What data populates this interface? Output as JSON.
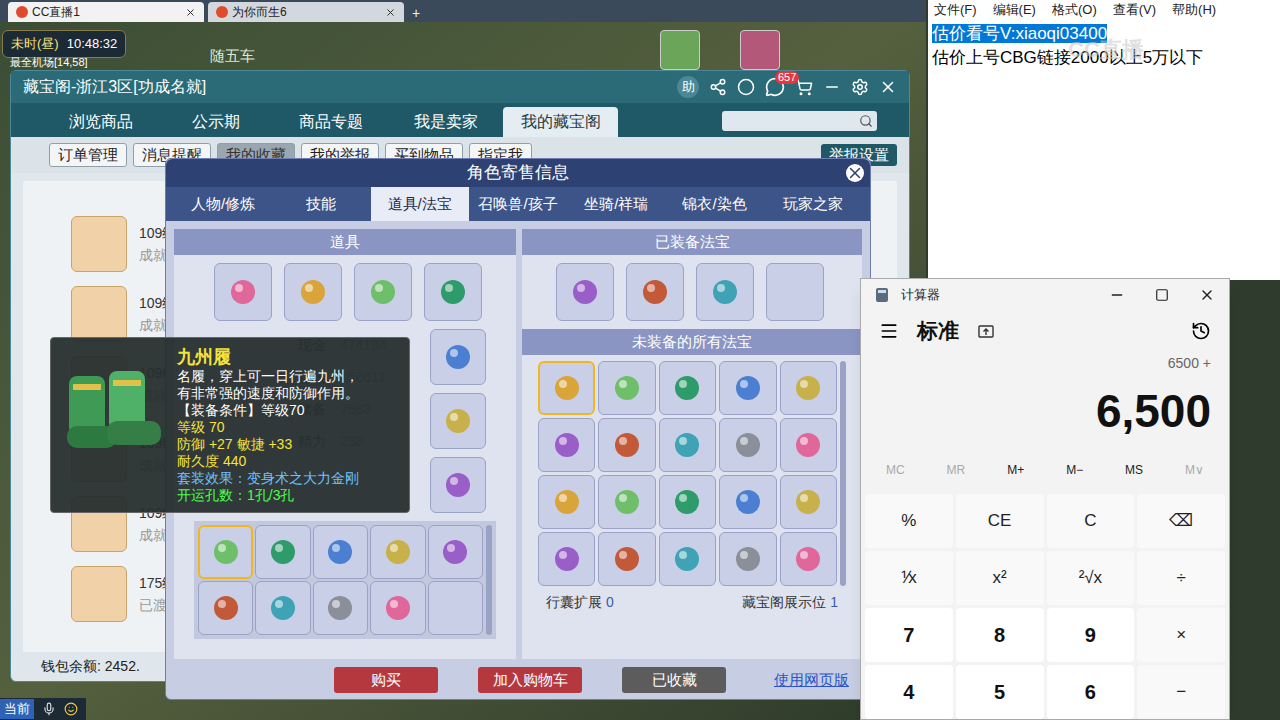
{
  "browser_tabs": [
    {
      "label": "CC直播1",
      "selected": true
    },
    {
      "label": "为你而生6",
      "selected": false
    }
  ],
  "new_tab": "+",
  "game_hud": {
    "time": "未时(昼)",
    "clock": "10:48:32",
    "location": "最全机场[14,58]",
    "npc": "随五车"
  },
  "cbg": {
    "title": "藏宝阁-浙江3区[功成名就]",
    "help": "助",
    "badge": "657",
    "tabs": [
      {
        "label": "浏览商品",
        "selected": false
      },
      {
        "label": "公示期",
        "selected": false
      },
      {
        "label": "商品专题",
        "selected": false
      },
      {
        "label": "我是卖家",
        "selected": false
      },
      {
        "label": "我的藏宝阁",
        "selected": true
      }
    ],
    "subtabs": [
      {
        "label": "订单管理",
        "selected": false
      },
      {
        "label": "消息提醒",
        "selected": false
      },
      {
        "label": "我的收藏",
        "selected": true
      },
      {
        "label": "我的举报",
        "selected": false
      },
      {
        "label": "买到物品",
        "selected": false
      },
      {
        "label": "指定我",
        "selected": false
      }
    ],
    "settings": "举报设置",
    "list": [
      {
        "level": "109级",
        "status": "成就"
      },
      {
        "level": "109级",
        "status": "成就"
      },
      {
        "level": "109级",
        "status": "成就"
      },
      {
        "level": "109级",
        "status": "成就"
      },
      {
        "level": "109级",
        "status": "成就"
      },
      {
        "level": "175级",
        "status": "已渡"
      }
    ],
    "balance": "钱包余额: 2452."
  },
  "dialog": {
    "title": "角色寄售信息",
    "tabs": [
      {
        "label": "人物/修炼",
        "selected": false
      },
      {
        "label": "技能",
        "selected": false
      },
      {
        "label": "道具/法宝",
        "selected": true
      },
      {
        "label": "召唤兽/孩子",
        "selected": false
      },
      {
        "label": "坐骑/祥瑞",
        "selected": false
      },
      {
        "label": "锦衣/染色",
        "selected": false
      },
      {
        "label": "玩家之家",
        "selected": false
      }
    ],
    "props_title": "道具",
    "stats": [
      {
        "label": "现金",
        "value": "474194"
      },
      {
        "label": "存银",
        "value": "256611"
      },
      {
        "label": "储备",
        "value": "7583"
      },
      {
        "label": "精力",
        "value": "238"
      }
    ],
    "props_top": [
      {
        "selected": false
      },
      {
        "selected": false
      },
      {
        "selected": false
      },
      {
        "selected": false
      }
    ],
    "props_side": [
      {
        "selected": false
      },
      {
        "selected": false
      },
      {
        "selected": false
      }
    ],
    "bag": [
      {
        "selected": true,
        "empty": false
      },
      {
        "selected": false,
        "empty": false
      },
      {
        "selected": false,
        "empty": false
      },
      {
        "selected": false,
        "empty": false
      },
      {
        "selected": false,
        "empty": false
      },
      {
        "selected": false,
        "empty": false
      },
      {
        "selected": false,
        "empty": false
      },
      {
        "selected": false,
        "empty": false
      },
      {
        "selected": false,
        "empty": false
      },
      {
        "selected": false,
        "empty": true
      }
    ],
    "equipped_title": "已装备法宝",
    "equipped": [
      {
        "empty": false
      },
      {
        "empty": false
      },
      {
        "empty": false
      },
      {
        "empty": true
      }
    ],
    "unequipped_title": "未装备的所有法宝",
    "unequipped": [
      {
        "selected": true
      },
      {
        "selected": false
      },
      {
        "selected": false
      },
      {
        "selected": false
      },
      {
        "selected": false
      },
      {
        "selected": false
      },
      {
        "selected": false
      },
      {
        "selected": false
      },
      {
        "selected": false
      },
      {
        "selected": false
      },
      {
        "selected": false
      },
      {
        "selected": false
      },
      {
        "selected": false
      },
      {
        "selected": false
      },
      {
        "selected": false
      },
      {
        "selected": false
      },
      {
        "selected": false
      },
      {
        "selected": false
      },
      {
        "selected": false
      },
      {
        "selected": false
      }
    ],
    "bag_label": "行囊扩展",
    "bag_value": "0",
    "showcase_label": "藏宝阁展示位",
    "showcase_value": "1",
    "buttons": [
      {
        "label": "购买",
        "kind": "red"
      },
      {
        "label": "加入购物车",
        "kind": "red"
      },
      {
        "label": "已收藏",
        "kind": "grey"
      }
    ],
    "web_link": "使用网页版"
  },
  "tooltip": {
    "name": "九州履",
    "desc_lines": [
      "名履，穿上可一日行遍九州，",
      "有非常强的速度和防御作用。",
      "【装备条件】等级70"
    ],
    "stat_lines": [
      "等级 70",
      "防御 +27 敏捷 +33",
      "耐久度 440"
    ],
    "set": "套装效果：变身术之大力金刚",
    "holes": "开运孔数：1孔/3孔"
  },
  "chat": {
    "channel": "当前"
  },
  "notepad": {
    "menu": [
      "文件(F)",
      "编辑(E)",
      "格式(O)",
      "查看(V)",
      "帮助(H)"
    ],
    "lines": [
      {
        "text": "估价看号V:xiaoqi03400",
        "selected": true
      },
      {
        "text": "估价上号CBG链接2000以上5万以下",
        "selected": false
      }
    ],
    "watermark": "CC直播"
  },
  "calculator": {
    "title": "计算器",
    "mode": "标准",
    "history": "6500 +",
    "display": "6,500",
    "memory": [
      {
        "label": "MC",
        "disabled": true
      },
      {
        "label": "MR",
        "disabled": true
      },
      {
        "label": "M+",
        "disabled": false
      },
      {
        "label": "M−",
        "disabled": false
      },
      {
        "label": "MS",
        "disabled": false
      },
      {
        "label": "M∨",
        "disabled": true
      }
    ],
    "keys": [
      {
        "label": "%",
        "kind": "op"
      },
      {
        "label": "CE",
        "kind": "op"
      },
      {
        "label": "C",
        "kind": "op"
      },
      {
        "label": "⌫",
        "kind": "op"
      },
      {
        "label": "⅟x",
        "kind": "op"
      },
      {
        "label": "x²",
        "kind": "op"
      },
      {
        "label": "²√x",
        "kind": "op"
      },
      {
        "label": "÷",
        "kind": "op"
      },
      {
        "label": "7",
        "kind": "digit"
      },
      {
        "label": "8",
        "kind": "digit"
      },
      {
        "label": "9",
        "kind": "digit"
      },
      {
        "label": "×",
        "kind": "op"
      },
      {
        "label": "4",
        "kind": "digit"
      },
      {
        "label": "5",
        "kind": "digit"
      },
      {
        "label": "6",
        "kind": "digit"
      },
      {
        "label": "−",
        "kind": "op"
      }
    ]
  }
}
